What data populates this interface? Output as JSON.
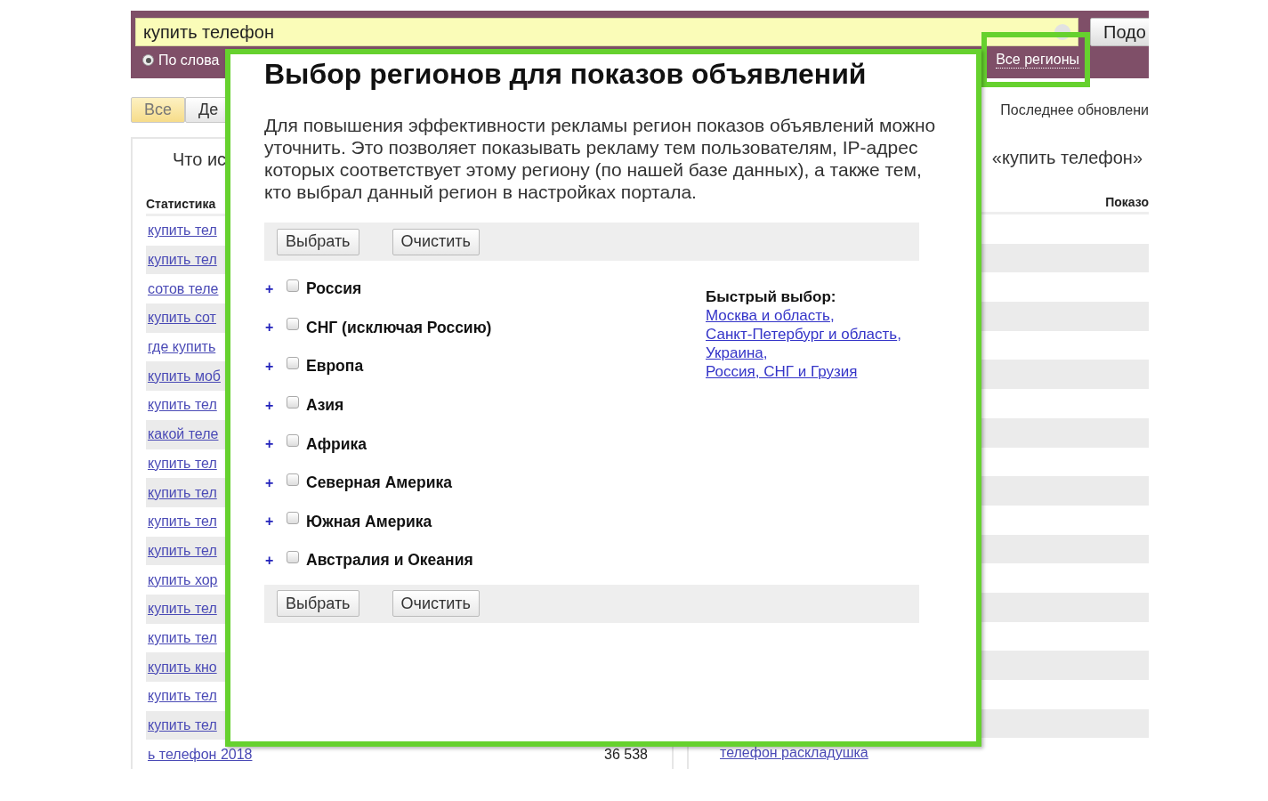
{
  "search": {
    "value": "купить телефон",
    "button": "Подо"
  },
  "mode_radio": {
    "label": "По слова",
    "selected": true
  },
  "region_link": "Все регионы",
  "tabs": [
    {
      "label": "Все",
      "selected": true
    },
    {
      "label": "Де",
      "selected": false
    }
  ],
  "last_update": "Последнее обновлени",
  "left_panel": {
    "heading": "Что ис",
    "column_1": "Статистика",
    "rows": [
      {
        "phrase": "купить тел"
      },
      {
        "phrase": "купить тел"
      },
      {
        "phrase": "сотов теле"
      },
      {
        "phrase": "купить сот"
      },
      {
        "phrase": "где купить"
      },
      {
        "phrase": "купить моб"
      },
      {
        "phrase": "купить тел"
      },
      {
        "phrase": "какой теле"
      },
      {
        "phrase": "купить тел"
      },
      {
        "phrase": "купить тел"
      },
      {
        "phrase": "купить тел"
      },
      {
        "phrase": "купить тел"
      },
      {
        "phrase": "купить хор"
      },
      {
        "phrase": "купить тел"
      },
      {
        "phrase": "купить тел"
      },
      {
        "phrase": "купить кно"
      },
      {
        "phrase": "купить тел"
      },
      {
        "phrase": "купить тел"
      },
      {
        "phrase": "ь телефон 2018",
        "count": "36 538"
      }
    ]
  },
  "right_panel": {
    "heading": "«купить телефон»",
    "column_1": "Показо",
    "last_row": "телефон раскладушка"
  },
  "dialog": {
    "title": "Выбор регионов для показов объявлений",
    "description": "Для повышения эффективности рекламы регион показов объявлений можно уточнить. Это позволяет показывать рекламу тем пользователям, IP-адрес которых соответствует этому региону (по нашей базе данных), а также тем, кто выбрал данный регион в настройках портала.",
    "buttons": [
      "Выбрать",
      "Очистить"
    ],
    "regions": [
      {
        "label": "Россия",
        "checked": false
      },
      {
        "label": "СНГ (исключая Россию)",
        "checked": false
      },
      {
        "label": "Европа",
        "checked": false
      },
      {
        "label": "Азия",
        "checked": false
      },
      {
        "label": "Африка",
        "checked": false
      },
      {
        "label": "Северная Америка",
        "checked": false
      },
      {
        "label": "Южная Америка",
        "checked": false
      },
      {
        "label": "Австралия и Океания",
        "checked": false
      }
    ],
    "expand_symbol": "+",
    "quick_pick": {
      "heading": "Быстрый выбор:",
      "links": [
        "Москва и область",
        "Санкт-Петербург и область",
        "Украина",
        "Россия, СНГ и Грузия"
      ],
      "separator": ","
    },
    "bottom_buttons": [
      "Выбрать",
      "Очистить"
    ]
  }
}
